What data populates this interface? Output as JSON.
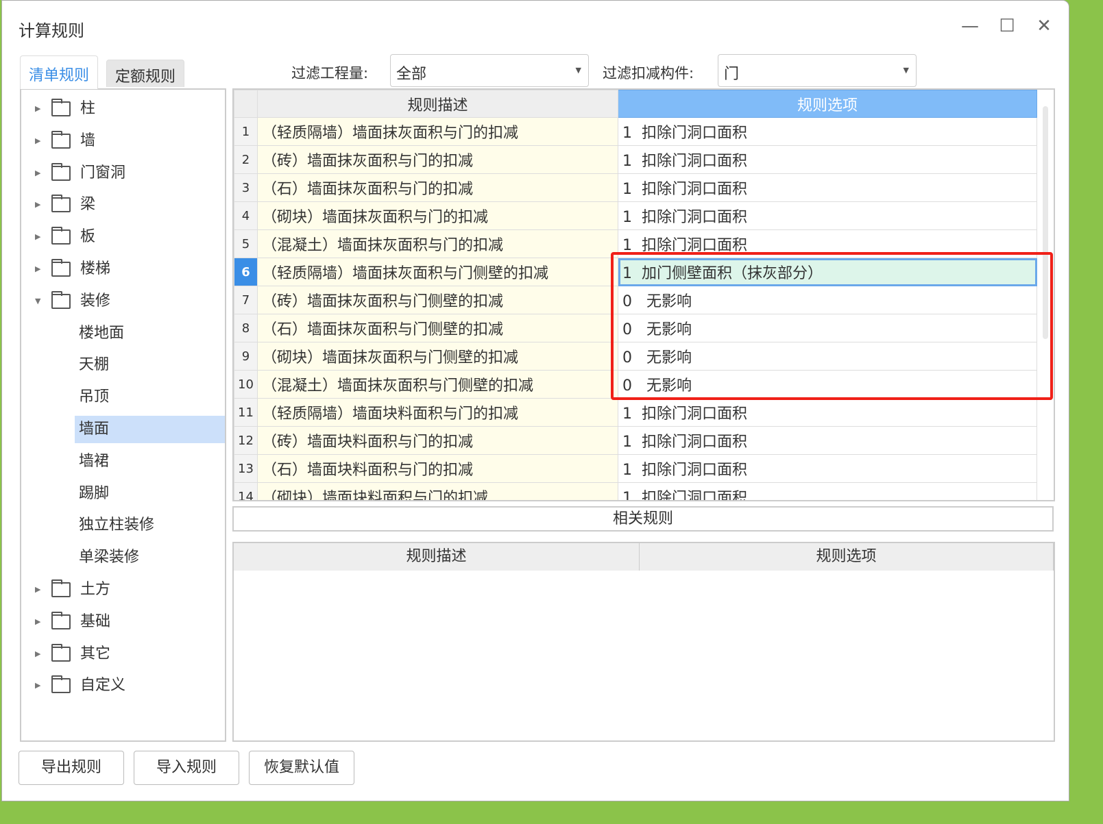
{
  "window": {
    "title": "计算规则",
    "minimize": "—",
    "maximize": "☐",
    "close": "✕"
  },
  "tabs": [
    "清单规则",
    "定额规则"
  ],
  "filters": {
    "qty_label": "过滤工程量:",
    "qty_value": "全部",
    "comp_label": "过滤扣减构件:",
    "comp_value": "门"
  },
  "tree": [
    {
      "label": "柱",
      "level": 0
    },
    {
      "label": "墙",
      "level": 0
    },
    {
      "label": "门窗洞",
      "level": 0
    },
    {
      "label": "梁",
      "level": 0
    },
    {
      "label": "板",
      "level": 0
    },
    {
      "label": "楼梯",
      "level": 0
    },
    {
      "label": "装修",
      "level": 0,
      "expanded": true
    },
    {
      "label": "楼地面",
      "level": 1
    },
    {
      "label": "天棚",
      "level": 1
    },
    {
      "label": "吊顶",
      "level": 1
    },
    {
      "label": "墙面",
      "level": 1,
      "selected": true
    },
    {
      "label": "墙裙",
      "level": 1
    },
    {
      "label": "踢脚",
      "level": 1
    },
    {
      "label": "独立柱装修",
      "level": 1
    },
    {
      "label": "单梁装修",
      "level": 1
    },
    {
      "label": "土方",
      "level": 0
    },
    {
      "label": "基础",
      "level": 0
    },
    {
      "label": "其它",
      "level": 0
    },
    {
      "label": "自定义",
      "level": 0
    }
  ],
  "table": {
    "headers": [
      "规则描述",
      "规则选项"
    ],
    "rows": [
      {
        "n": "1",
        "desc": "（轻质隔墙）墙面抹灰面积与门的扣减",
        "opt": "1  扣除门洞口面积"
      },
      {
        "n": "2",
        "desc": "（砖）墙面抹灰面积与门的扣减",
        "opt": "1  扣除门洞口面积"
      },
      {
        "n": "3",
        "desc": "（石）墙面抹灰面积与门的扣减",
        "opt": "1  扣除门洞口面积"
      },
      {
        "n": "4",
        "desc": "（砌块）墙面抹灰面积与门的扣减",
        "opt": "1  扣除门洞口面积"
      },
      {
        "n": "5",
        "desc": "（混凝土）墙面抹灰面积与门的扣减",
        "opt": "1  扣除门洞口面积"
      },
      {
        "n": "6",
        "desc": "（轻质隔墙）墙面抹灰面积与门侧壁的扣减",
        "opt": "1  加门侧壁面积（抹灰部分）",
        "selected": true
      },
      {
        "n": "7",
        "desc": "（砖）墙面抹灰面积与门侧壁的扣减",
        "opt": "0   无影响"
      },
      {
        "n": "8",
        "desc": "（石）墙面抹灰面积与门侧壁的扣减",
        "opt": "0   无影响"
      },
      {
        "n": "9",
        "desc": "（砌块）墙面抹灰面积与门侧壁的扣减",
        "opt": "0   无影响"
      },
      {
        "n": "10",
        "desc": "（混凝土）墙面抹灰面积与门侧壁的扣减",
        "opt": "0   无影响"
      },
      {
        "n": "11",
        "desc": "（轻质隔墙）墙面块料面积与门的扣减",
        "opt": "1  扣除门洞口面积"
      },
      {
        "n": "12",
        "desc": "（砖）墙面块料面积与门的扣减",
        "opt": "1  扣除门洞口面积"
      },
      {
        "n": "13",
        "desc": "（石）墙面块料面积与门的扣减",
        "opt": "1  扣除门洞口面积"
      },
      {
        "n": "14",
        "desc": "（砌块）墙面块料面积与门的扣减",
        "opt": "1  扣除门洞口面积"
      }
    ]
  },
  "related": {
    "title": "相关规则",
    "headers": [
      "规则描述",
      "规则选项"
    ]
  },
  "buttons": [
    "导出规则",
    "导入规则",
    "恢复默认值"
  ]
}
